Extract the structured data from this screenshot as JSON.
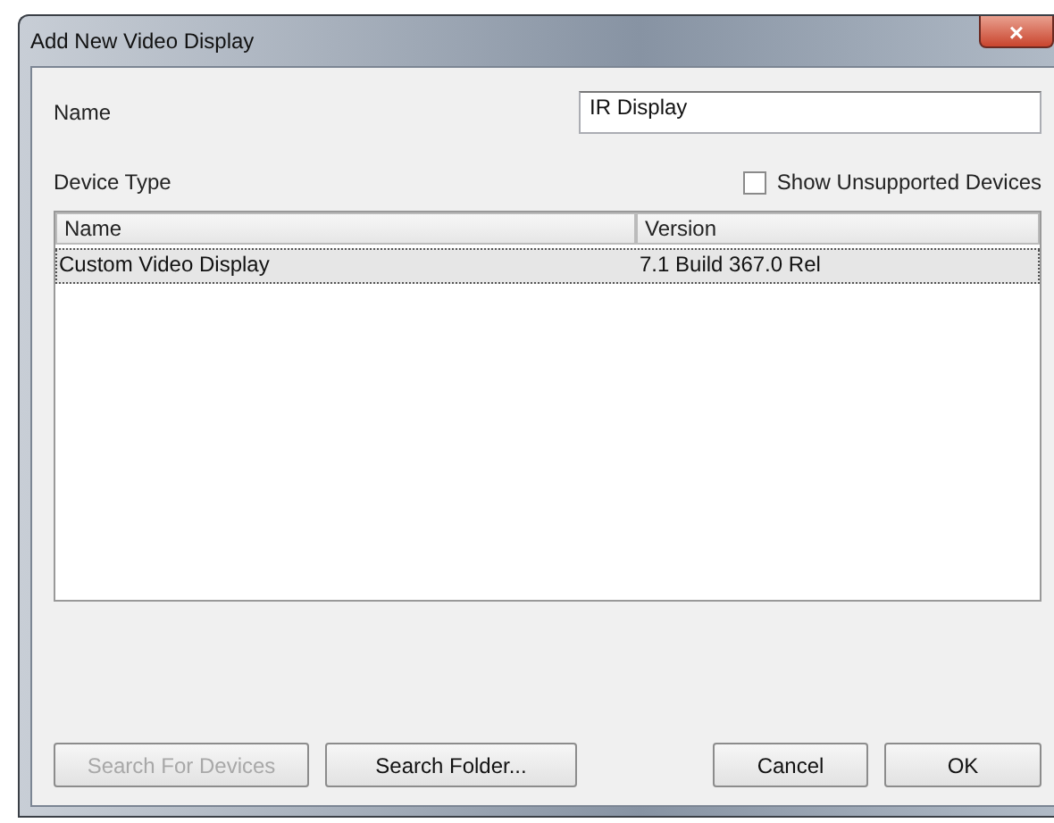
{
  "window": {
    "title": "Add New Video Display",
    "close": "×"
  },
  "name_field": {
    "label": "Name",
    "value": "IR Display"
  },
  "device_type": {
    "label": "Device Type"
  },
  "show_unsupported": {
    "label": "Show Unsupported Devices",
    "checked": false
  },
  "table": {
    "columns": [
      "Name",
      "Version"
    ],
    "rows": [
      {
        "cells": [
          "Custom Video Display",
          "7.1 Build 367.0 Rel"
        ],
        "selected": true
      }
    ]
  },
  "buttons": [
    {
      "label": "Search For Devices",
      "disabled": true
    },
    {
      "label": "Search Folder...",
      "disabled": false
    },
    {
      "label": "Cancel",
      "disabled": false
    },
    {
      "label": "OK",
      "disabled": false
    }
  ]
}
